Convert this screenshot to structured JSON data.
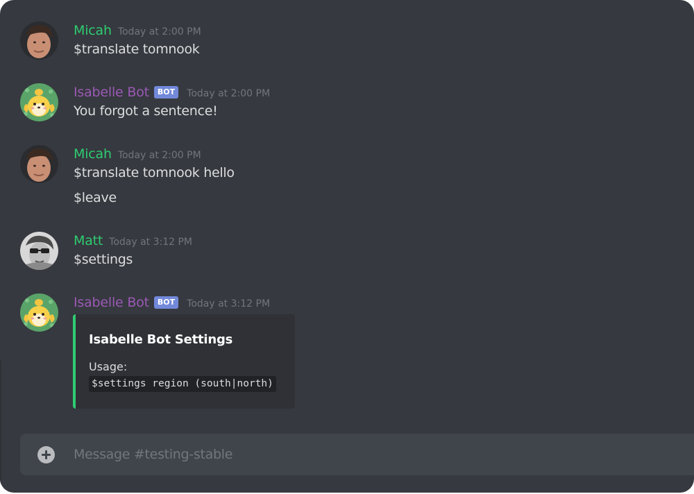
{
  "colors": {
    "background": "#36393f",
    "member_green": "#2ecc71",
    "bot_purple": "#9b59b6",
    "bot_tag": "#7289da",
    "timestamp_gray": "#72767d",
    "embed_accent": "#2ecc71"
  },
  "messages": [
    {
      "author": "Micah",
      "timestamp": "Today at 2:00 PM",
      "lines": [
        "$translate tomnook"
      ]
    },
    {
      "author": "Isabelle Bot",
      "bot_tag": "BOT",
      "timestamp": "Today at 2:00 PM",
      "lines": [
        "You forgot a sentence!"
      ]
    },
    {
      "author": "Micah",
      "timestamp": "Today at 2:00 PM",
      "lines": [
        "$translate tomnook hello",
        "$leave"
      ]
    },
    {
      "author": "Matt",
      "timestamp": "Today at 3:12 PM",
      "lines": [
        "$settings"
      ]
    },
    {
      "author": "Isabelle Bot",
      "bot_tag": "BOT",
      "timestamp": "Today at 3:12 PM",
      "embed": {
        "title": "Isabelle Bot Settings",
        "field_name": "Usage:",
        "field_code": "$settings region (south|north)"
      }
    }
  ],
  "composer": {
    "placeholder": "Message #testing-stable",
    "add_icon": "plus-circle-icon"
  }
}
